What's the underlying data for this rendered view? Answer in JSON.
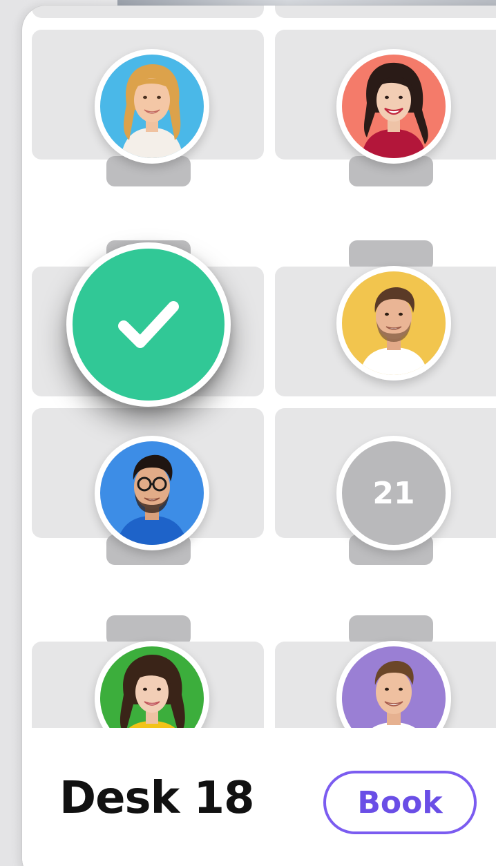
{
  "desk_map": {
    "selected_desk_status": "selected",
    "available_desk_number": "21",
    "occupants": [
      {
        "icon": "woman-blonde-avatar",
        "bg": "#4ab8e8"
      },
      {
        "icon": "woman-dark-hair-avatar",
        "bg": "#f47b6a"
      },
      {
        "icon": "man-beard-avatar",
        "bg": "#f2c54e"
      },
      {
        "icon": "man-glasses-avatar",
        "bg": "#3d8de6"
      },
      {
        "icon": "woman-curly-hair-avatar",
        "bg": "#3cae3c"
      },
      {
        "icon": "young-man-avatar",
        "bg": "#9a7fd4"
      }
    ]
  },
  "colors": {
    "selected_green": "#31c896",
    "accent_purple": "#7b5cf0",
    "desk_gray": "#e6e6e7",
    "chair_gray": "#bdbdbf"
  },
  "booking": {
    "desk_label": "Desk 18",
    "book_label": "Book"
  }
}
